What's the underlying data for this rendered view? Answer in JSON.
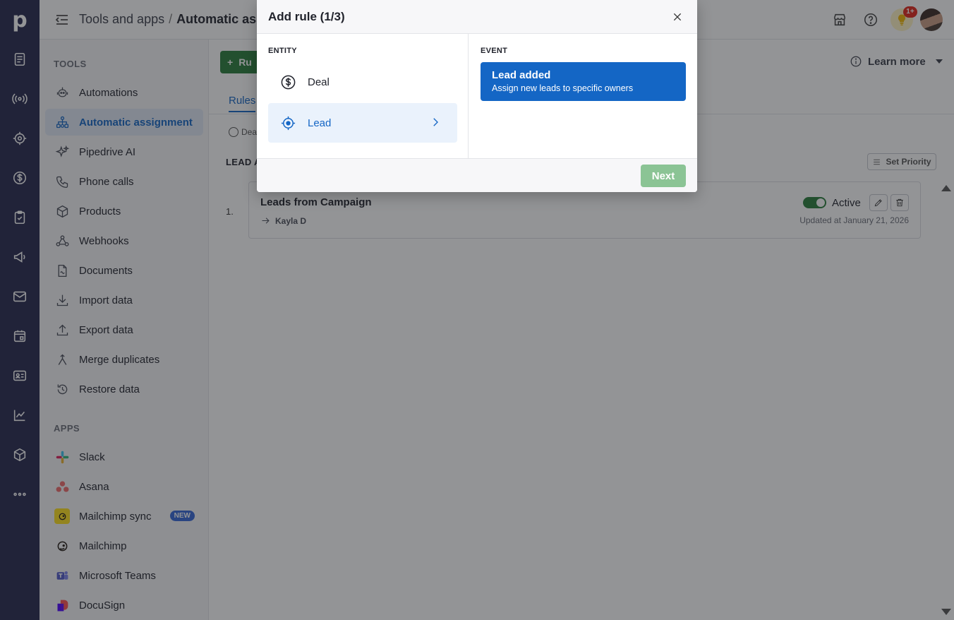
{
  "header": {
    "breadcrumb_root": "Tools and apps",
    "breadcrumb_sep": "/",
    "breadcrumb_current": "Automatic assig",
    "tips_count": "1+"
  },
  "sidebar": {
    "tools_heading": "TOOLS",
    "tools": [
      {
        "label": "Automations",
        "icon": "robot-icon"
      },
      {
        "label": "Automatic assignment",
        "icon": "assignment-tree-icon",
        "active": true
      },
      {
        "label": "Pipedrive AI",
        "icon": "sparkles-icon"
      },
      {
        "label": "Phone calls",
        "icon": "phone-icon"
      },
      {
        "label": "Products",
        "icon": "box-icon"
      },
      {
        "label": "Webhooks",
        "icon": "webhook-icon"
      },
      {
        "label": "Documents",
        "icon": "document-icon"
      },
      {
        "label": "Import data",
        "icon": "download-icon"
      },
      {
        "label": "Export data",
        "icon": "upload-icon"
      },
      {
        "label": "Merge duplicates",
        "icon": "merge-icon"
      },
      {
        "label": "Restore data",
        "icon": "restore-icon"
      }
    ],
    "apps_heading": "APPS",
    "apps": [
      {
        "label": "Slack",
        "icon": "slack-icon"
      },
      {
        "label": "Asana",
        "icon": "asana-icon"
      },
      {
        "label": "Mailchimp sync",
        "icon": "mailchimp-sync-icon",
        "badge": "NEW"
      },
      {
        "label": "Mailchimp",
        "icon": "mailchimp-icon"
      },
      {
        "label": "Microsoft Teams",
        "icon": "teams-icon"
      },
      {
        "label": "DocuSign",
        "icon": "docusign-icon"
      }
    ]
  },
  "main": {
    "add_rule_label": "Ru",
    "learn_more_label": "Learn more",
    "tab_rules": "Rules",
    "filter_label": "Dea",
    "section_heading": "LEAD A",
    "set_priority_label": "Set Priority",
    "rules": [
      {
        "index": "1.",
        "title": "Leads from Campaign",
        "owner": "Kayla D",
        "status_label": "Active",
        "updated": "Updated at January 21, 2026"
      }
    ]
  },
  "modal": {
    "title": "Add rule (1/3)",
    "entity_heading": "ENTITY",
    "event_heading": "EVENT",
    "entities": [
      {
        "label": "Deal",
        "icon": "dollar-circle-icon"
      },
      {
        "label": "Lead",
        "icon": "target-icon",
        "selected": true
      }
    ],
    "event": {
      "title": "Lead added",
      "description": "Assign new leads to specific owners"
    },
    "next_label": "Next"
  },
  "colors": {
    "rail": "#26284e",
    "accent_blue": "#1466c5",
    "green": "#2a7d3b",
    "next_disabled": "#8bc495"
  }
}
